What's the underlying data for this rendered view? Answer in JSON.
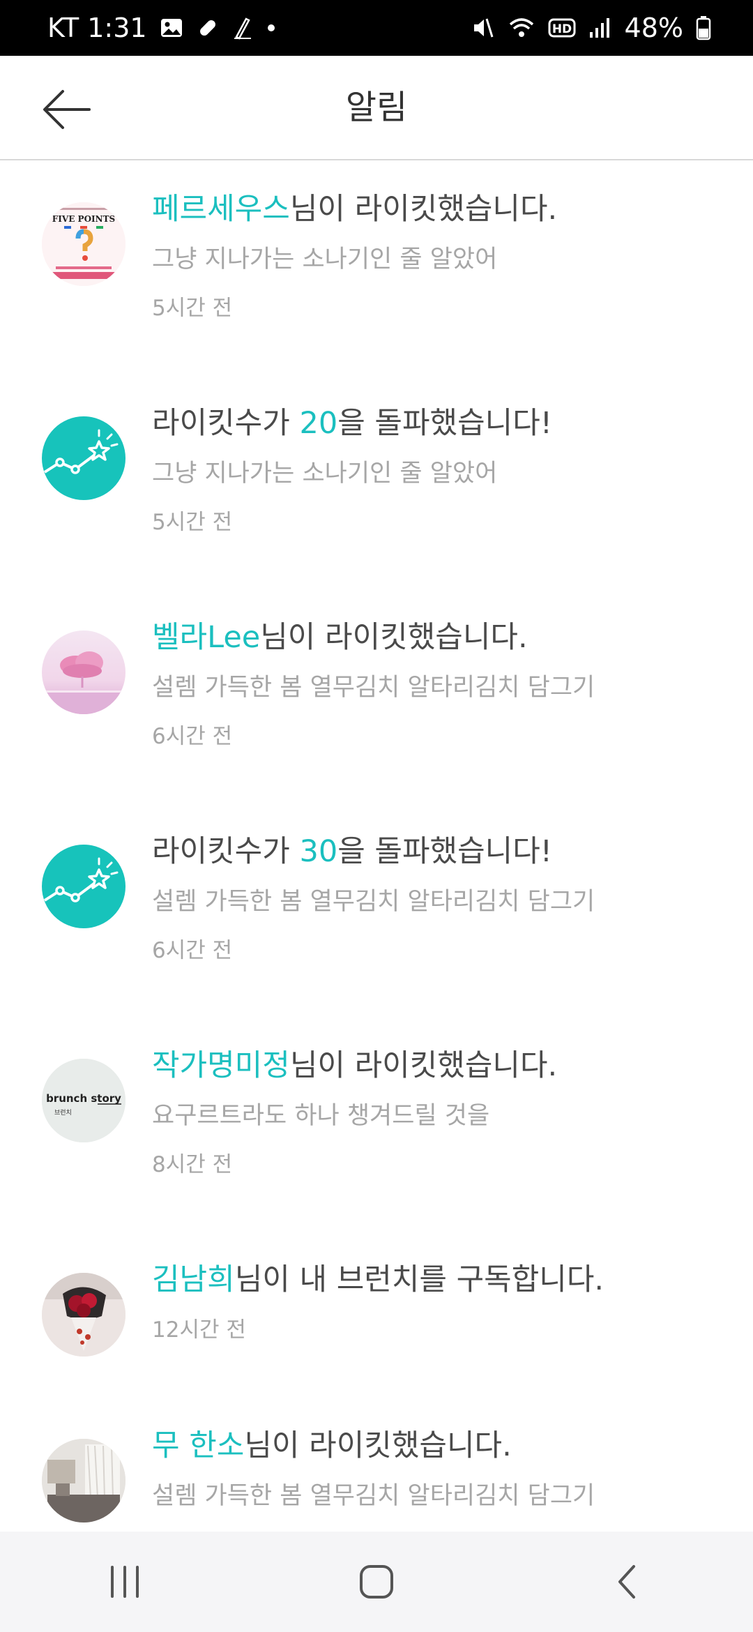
{
  "status_bar": {
    "carrier_time": "KT 1:31",
    "battery": "48%"
  },
  "header": {
    "title": "알림"
  },
  "notifications": [
    {
      "pre": "",
      "highlight": "페르세우스",
      "post": "님이 라이킷했습니다.",
      "subtitle": "그냥 지나가는 소나기인 줄 알았어",
      "time": "5시간 전",
      "avatar": "book-cover-five-points"
    },
    {
      "pre": "라이킷수가 ",
      "highlight": "20",
      "post": "을 돌파했습니다!",
      "subtitle": "그냥 지나가는 소나기인 줄 알았어",
      "time": "5시간 전",
      "avatar": "milestone-chart-icon"
    },
    {
      "pre": "",
      "highlight": "벨라Lee",
      "post": "님이 라이킷했습니다.",
      "subtitle": "설렘 가득한 봄 열무김치 알타리김치 담그기",
      "time": "6시간 전",
      "avatar": "pink-cloud-photo"
    },
    {
      "pre": "라이킷수가 ",
      "highlight": "30",
      "post": "을 돌파했습니다!",
      "subtitle": "설렘 가득한 봄 열무김치 알타리김치 담그기",
      "time": "6시간 전",
      "avatar": "milestone-chart-icon"
    },
    {
      "pre": "",
      "highlight": "작가명미정",
      "post": "님이 라이킷했습니다.",
      "subtitle": "요구르트라도 하나 챙겨드릴 것을",
      "time": "8시간 전",
      "avatar": "brunch-story-logo"
    },
    {
      "pre": "",
      "highlight": "김남희",
      "post": "님이 내 브런치를 구독합니다.",
      "subtitle": "",
      "time": "12시간 전",
      "avatar": "flower-bouquet-photo"
    },
    {
      "pre": "",
      "highlight": "무 한소",
      "post": "님이 라이킷했습니다.",
      "subtitle": "설렘 가득한 봄 열무김치 알타리김치 담그기",
      "time": "",
      "avatar": "room-photo"
    }
  ],
  "brunch_logo": {
    "line1": "brunch story",
    "line2": "브런치"
  },
  "book_cover": {
    "title": "FIVE POINTS"
  },
  "colors": {
    "accent": "#1bbfbf",
    "milestone_bg": "#17c3bb"
  }
}
